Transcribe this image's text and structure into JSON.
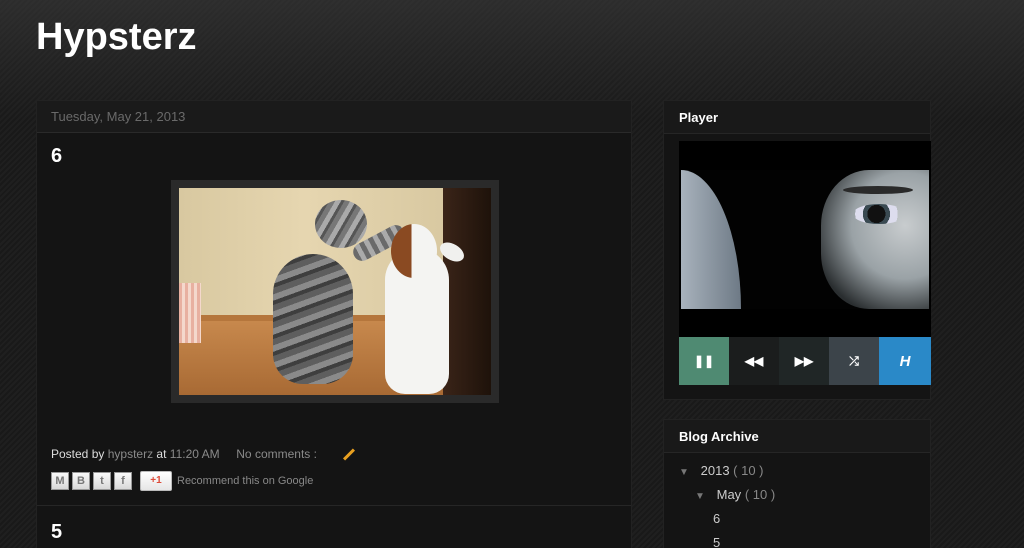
{
  "blog": {
    "title": "Hypsterz"
  },
  "post1": {
    "date": "Tuesday, May 21, 2013",
    "title": "6",
    "footer": {
      "posted_by_label": "Posted by",
      "author": "hypsterz",
      "at_label": "at",
      "time": "11:20 AM",
      "comments": "No comments :"
    },
    "share": {
      "email": "M",
      "blog": "B",
      "twitter": "t",
      "facebook": "f",
      "plusone": "+1",
      "recommend": "Recommend this on Google"
    }
  },
  "post2": {
    "title": "5"
  },
  "player_widget": {
    "title": "Player",
    "controls": {
      "pause": "❚❚",
      "rewind": "◀◀",
      "forward": "▶▶",
      "shuffle": "⤮",
      "logo": "H"
    }
  },
  "archive_widget": {
    "title": "Blog Archive",
    "year": {
      "label": "2013",
      "count": "( 10 )"
    },
    "month": {
      "label": "May",
      "count": "( 10 )"
    },
    "posts": [
      "6",
      "5"
    ]
  },
  "icons": [
    "pencil-icon",
    "pause-icon",
    "rewind-icon",
    "fast-forward-icon",
    "shuffle-icon",
    "triangle-down-icon"
  ]
}
